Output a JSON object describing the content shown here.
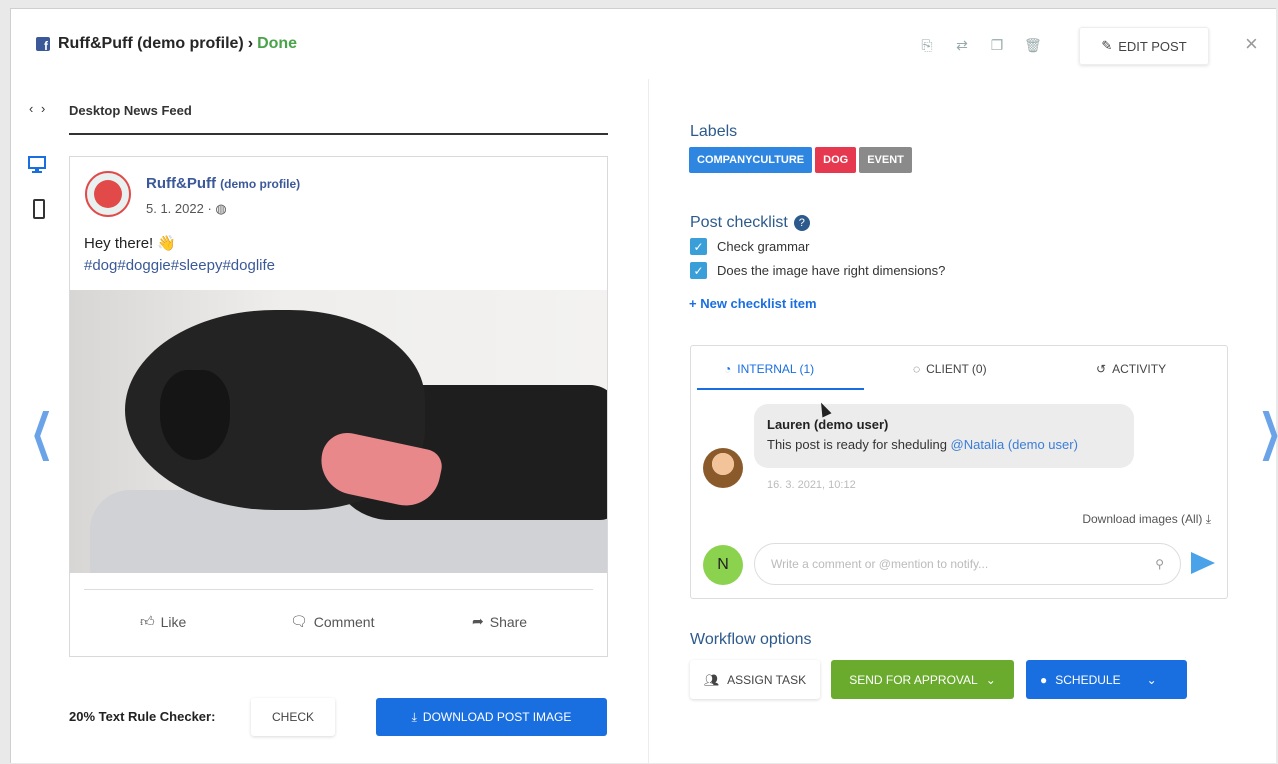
{
  "header": {
    "profile": "Ruff&Puff (demo profile)",
    "separator": "›",
    "status": "Done",
    "edit_label": "EDIT POST",
    "icons": [
      "copy-icon",
      "swap-icon",
      "duplicate-icon",
      "trash-icon"
    ],
    "close": "×"
  },
  "preview": {
    "nav_arrows": "‹ ›",
    "feed_label": "Desktop News Feed",
    "post": {
      "page_name": "Ruff&Puff",
      "page_name_suffix": "(demo profile)",
      "date": "5. 1. 2022 ·",
      "text": "Hey there! 👋",
      "hashtags": "#dog#doggie#sleepy#doglife",
      "actions": [
        "Like",
        "Comment",
        "Share"
      ]
    },
    "checker_label": "20% Text Rule Checker:",
    "check_label": "CHECK",
    "download_label": "DOWNLOAD POST IMAGE"
  },
  "labels": {
    "title": "Labels",
    "items": [
      {
        "text": "COMPANYCULTURE",
        "color": "#2f86e0"
      },
      {
        "text": "DOG",
        "color": "#e63950"
      },
      {
        "text": "EVENT",
        "color": "#8a8a8a"
      }
    ]
  },
  "checklist": {
    "title": "Post checklist",
    "help": "?",
    "items": [
      "Check grammar",
      "Does the image have right dimensions?"
    ],
    "new_item": "+ New checklist item"
  },
  "comments": {
    "tabs": [
      "INTERNAL (1)",
      "CLIENT (0)",
      "ACTIVITY"
    ],
    "comment": {
      "author": "Lauren (demo user)",
      "text": "This post is ready for sheduling ",
      "mention": "@Natalia (demo user)",
      "time": "16. 3. 2021, 10:12"
    },
    "download_all": "Download images (All) ⤓",
    "user_initial": "N",
    "input_placeholder": "Write a comment or @mention to notify..."
  },
  "workflow": {
    "title": "Workflow options",
    "assign_label": "ASSIGN TASK",
    "approval_label": "SEND FOR APPROVAL",
    "schedule_label": "SCHEDULE",
    "colors": {
      "approval": "#6aab2e",
      "schedule": "#1a6fe0"
    }
  }
}
